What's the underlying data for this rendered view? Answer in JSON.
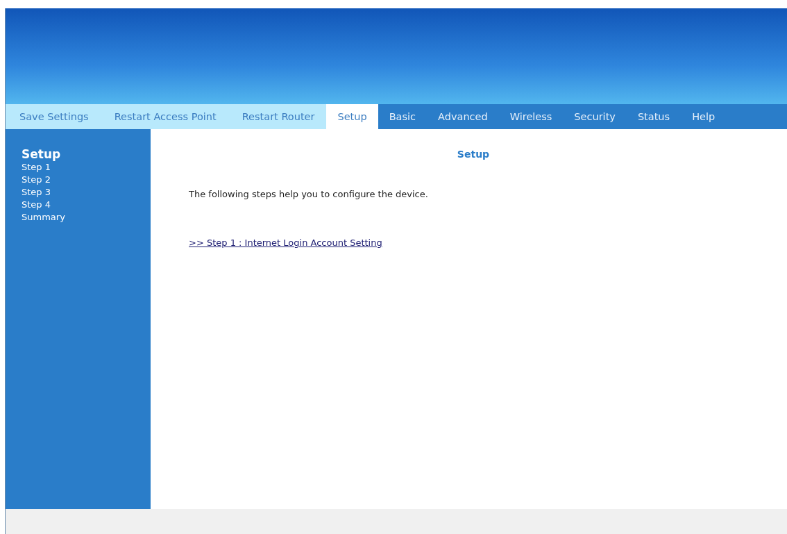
{
  "nav": [
    {
      "label": "Save Settings",
      "kind": "action",
      "selected": false
    },
    {
      "label": "Restart Access Point",
      "kind": "action",
      "selected": false
    },
    {
      "label": "Restart Router",
      "kind": "action",
      "selected": false
    },
    {
      "label": "Setup",
      "kind": "section",
      "selected": true
    },
    {
      "label": "Basic",
      "kind": "section",
      "selected": false
    },
    {
      "label": "Advanced",
      "kind": "section",
      "selected": false
    },
    {
      "label": "Wireless",
      "kind": "section",
      "selected": false
    },
    {
      "label": "Security",
      "kind": "section",
      "selected": false
    },
    {
      "label": "Status",
      "kind": "section",
      "selected": false
    },
    {
      "label": "Help",
      "kind": "section",
      "selected": false
    }
  ],
  "sidebar": {
    "title": "Setup",
    "items": [
      "Step 1",
      "Step 2",
      "Step 3",
      "Step 4",
      "Summary"
    ]
  },
  "content": {
    "title": "Setup",
    "intro": "The following steps help you to configure the device.",
    "link": ">> Step 1 : Internet Login Account Setting"
  }
}
